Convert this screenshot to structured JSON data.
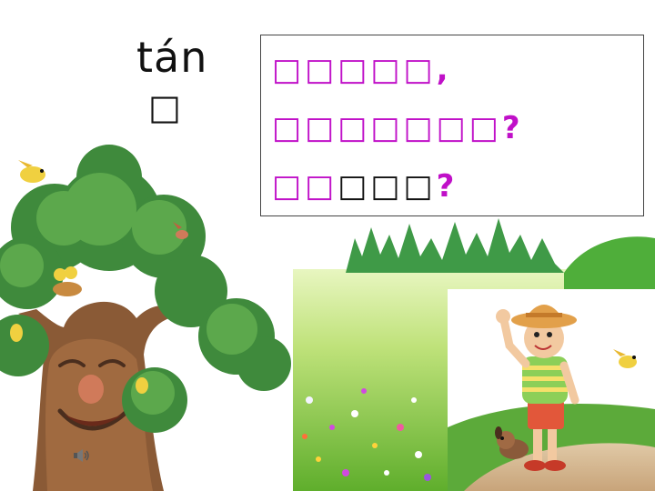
{
  "pinyin": "tán",
  "char": "□",
  "text_lines": {
    "line1": "□□□□□,",
    "line2_boxes": "□□□□□□□",
    "line2_end": "?",
    "line3_magenta": "□□",
    "line3_black": "□□□",
    "line3_end": "?"
  },
  "colors": {
    "accent": "#c010c8",
    "text": "#111111",
    "border": "#444444"
  },
  "icons": {
    "speaker": "speaker-icon"
  }
}
